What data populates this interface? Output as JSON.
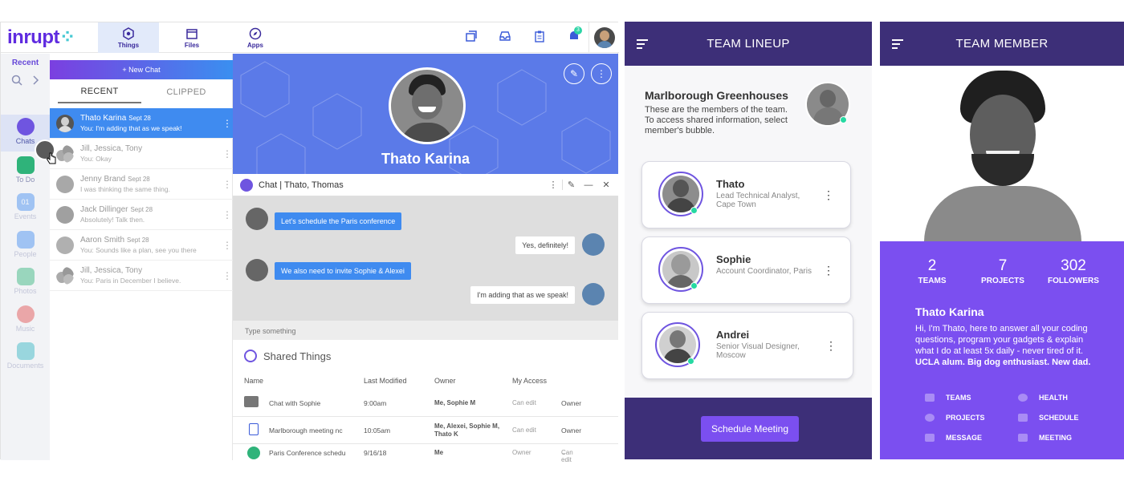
{
  "app": {
    "logo": "inrupt",
    "nav": [
      {
        "label": "Things"
      },
      {
        "label": "Files"
      },
      {
        "label": "Apps"
      }
    ],
    "notification_count": "3"
  },
  "rail": {
    "recent_label": "Recent",
    "items": [
      {
        "label": "Chats",
        "color": "#6f55e0"
      },
      {
        "label": "To Do",
        "color": "#2fb37a"
      },
      {
        "label": "Events",
        "color": "#3f8bf0"
      },
      {
        "label": "People",
        "color": "#3f8bf0"
      },
      {
        "label": "Photos",
        "color": "#2fb37a"
      },
      {
        "label": "Music",
        "color": "#e24b4b"
      },
      {
        "label": "Documents",
        "color": "#2fb3c2"
      }
    ]
  },
  "chatlist": {
    "new_chat": "+ New Chat",
    "tabs": [
      "RECENT",
      "CLIPPED"
    ],
    "chats": [
      {
        "name": "Thato Karina",
        "date": "Sept 28",
        "msg": "You: I'm adding that as we speak!",
        "selected": true
      },
      {
        "name": "Jill, Jessica, Tony",
        "date": "",
        "msg": "You: Okay"
      },
      {
        "name": "Jenny Brand",
        "date": "Sept 28",
        "msg": "I was thinking the same thing."
      },
      {
        "name": "Jack Dillinger",
        "date": "Sept 28",
        "msg": "Absolutely! Talk then."
      },
      {
        "name": "Aaron Smith",
        "date": "Sept 28",
        "msg": "You: Sounds like a plan, see you there"
      },
      {
        "name": "Jill, Jessica, Tony",
        "date": "",
        "msg": "You: Paris in December I believe."
      }
    ]
  },
  "profile_header": {
    "name": "Thato Karina"
  },
  "chat": {
    "title": "Chat | Thato, Thomas",
    "messages": [
      {
        "text": "Let's schedule the Paris conference",
        "dir": "in"
      },
      {
        "text": "Yes, definitely!",
        "dir": "out"
      },
      {
        "text": "We also need to invite Sophie & Alexei",
        "dir": "in"
      },
      {
        "text": "I'm adding that as we speak!",
        "dir": "out"
      }
    ],
    "input_placeholder": "Type something"
  },
  "shared": {
    "title": "Shared Things",
    "columns": [
      "Name",
      "Last Modified",
      "Owner",
      "My Access"
    ],
    "rows": [
      {
        "name": "Chat with Sophie",
        "modified": "9:00am",
        "owner": "Me, Sophie M",
        "access": "Can edit",
        "role": "Owner"
      },
      {
        "name": "Marlborough meeting nc",
        "modified": "10:05am",
        "owner": "Me, Alexei, Sophie M, Thato K",
        "access": "Can edit",
        "role": "Owner"
      },
      {
        "name": "Paris Conference schedu",
        "modified": "9/16/18",
        "owner": "Me",
        "access": "Owner",
        "role": "Can edit"
      }
    ]
  },
  "team_lineup": {
    "header": "TEAM LINEUP",
    "org": "Marlborough Greenhouses",
    "description": "These are the members of the team. To access shared information, select member's bubble.",
    "members": [
      {
        "name": "Thato",
        "role": "Lead Technical Analyst, Cape Town"
      },
      {
        "name": "Sophie",
        "role": "Account Coordinator, Paris"
      },
      {
        "name": "Andrei",
        "role": "Senior Visual Designer, Moscow"
      }
    ],
    "button": "Schedule Meeting"
  },
  "team_member": {
    "header": "TEAM MEMBER",
    "stats": [
      {
        "value": "2",
        "label": "TEAMS"
      },
      {
        "value": "7",
        "label": "PROJECTS"
      },
      {
        "value": "302",
        "label": "FOLLOWERS"
      }
    ],
    "name": "Thato Karina",
    "bio": "Hi, I'm Thato, here to answer all your coding questions, program your gadgets & explain what I do at least 5x daily - never tired of it.",
    "bio_bold": "UCLA alum. Big dog enthusiast. New dad.",
    "menu": [
      {
        "label": "TEAMS"
      },
      {
        "label": "HEALTH"
      },
      {
        "label": "PROJECTS"
      },
      {
        "label": "SCHEDULE"
      },
      {
        "label": "MESSAGE"
      },
      {
        "label": "MEETING"
      }
    ]
  }
}
